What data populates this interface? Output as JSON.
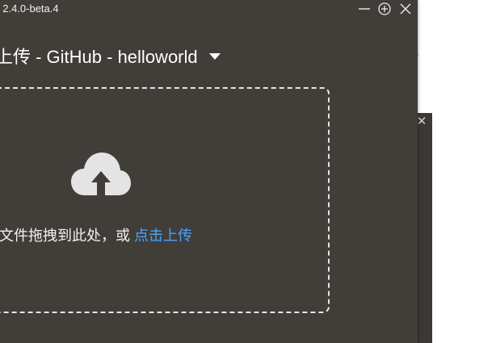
{
  "window": {
    "version": "2.4.0-beta.4",
    "version_prefix": ": "
  },
  "heading": {
    "title": "上传 - GitHub - helloworld"
  },
  "dropzone": {
    "hint": "文件拖拽到此处，或 ",
    "link": "点击上传"
  },
  "icons": {
    "minimize": "minimize-icon",
    "maximize": "plus-circle-icon",
    "close": "close-icon",
    "upload": "cloud-upload-icon",
    "caret": "caret-down-icon"
  },
  "colors": {
    "window_bg": "#413e39",
    "text": "#ffffff",
    "link": "#4aa3ff",
    "border": "#e6e6e6"
  }
}
